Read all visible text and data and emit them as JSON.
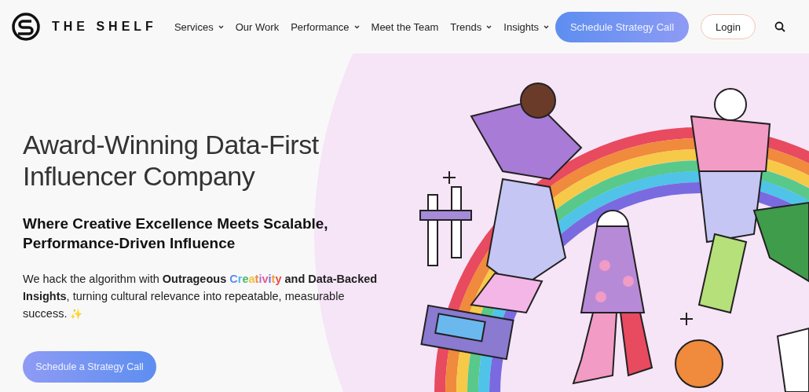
{
  "header": {
    "logo_text": "THE SHELF",
    "nav": [
      {
        "label": "Services",
        "has_dropdown": true
      },
      {
        "label": "Our Work",
        "has_dropdown": false
      },
      {
        "label": "Performance",
        "has_dropdown": true
      },
      {
        "label": "Meet the Team",
        "has_dropdown": false
      },
      {
        "label": "Trends",
        "has_dropdown": true
      },
      {
        "label": "Insights",
        "has_dropdown": true
      }
    ],
    "cta": "Schedule Strategy Call",
    "login": "Login"
  },
  "hero": {
    "title": "Award-Winning Data-First Influencer Company",
    "subtitle": "Where Creative Excellence Meets Scalable, Performance-Driven Influence",
    "description": [
      {
        "kind": "plain",
        "text": "We hack the algorithm with "
      },
      {
        "kind": "bold",
        "text": "Outrageous "
      },
      {
        "kind": "rainbow",
        "text": "Creativity"
      },
      {
        "kind": "bold",
        "text": " and Data-Backed Insights"
      },
      {
        "kind": "plain",
        "text": ", turning cultural relevance into repeatable, measurable success. "
      },
      {
        "kind": "sparkle",
        "text": "✨"
      }
    ],
    "button": "Schedule a Strategy Call"
  }
}
